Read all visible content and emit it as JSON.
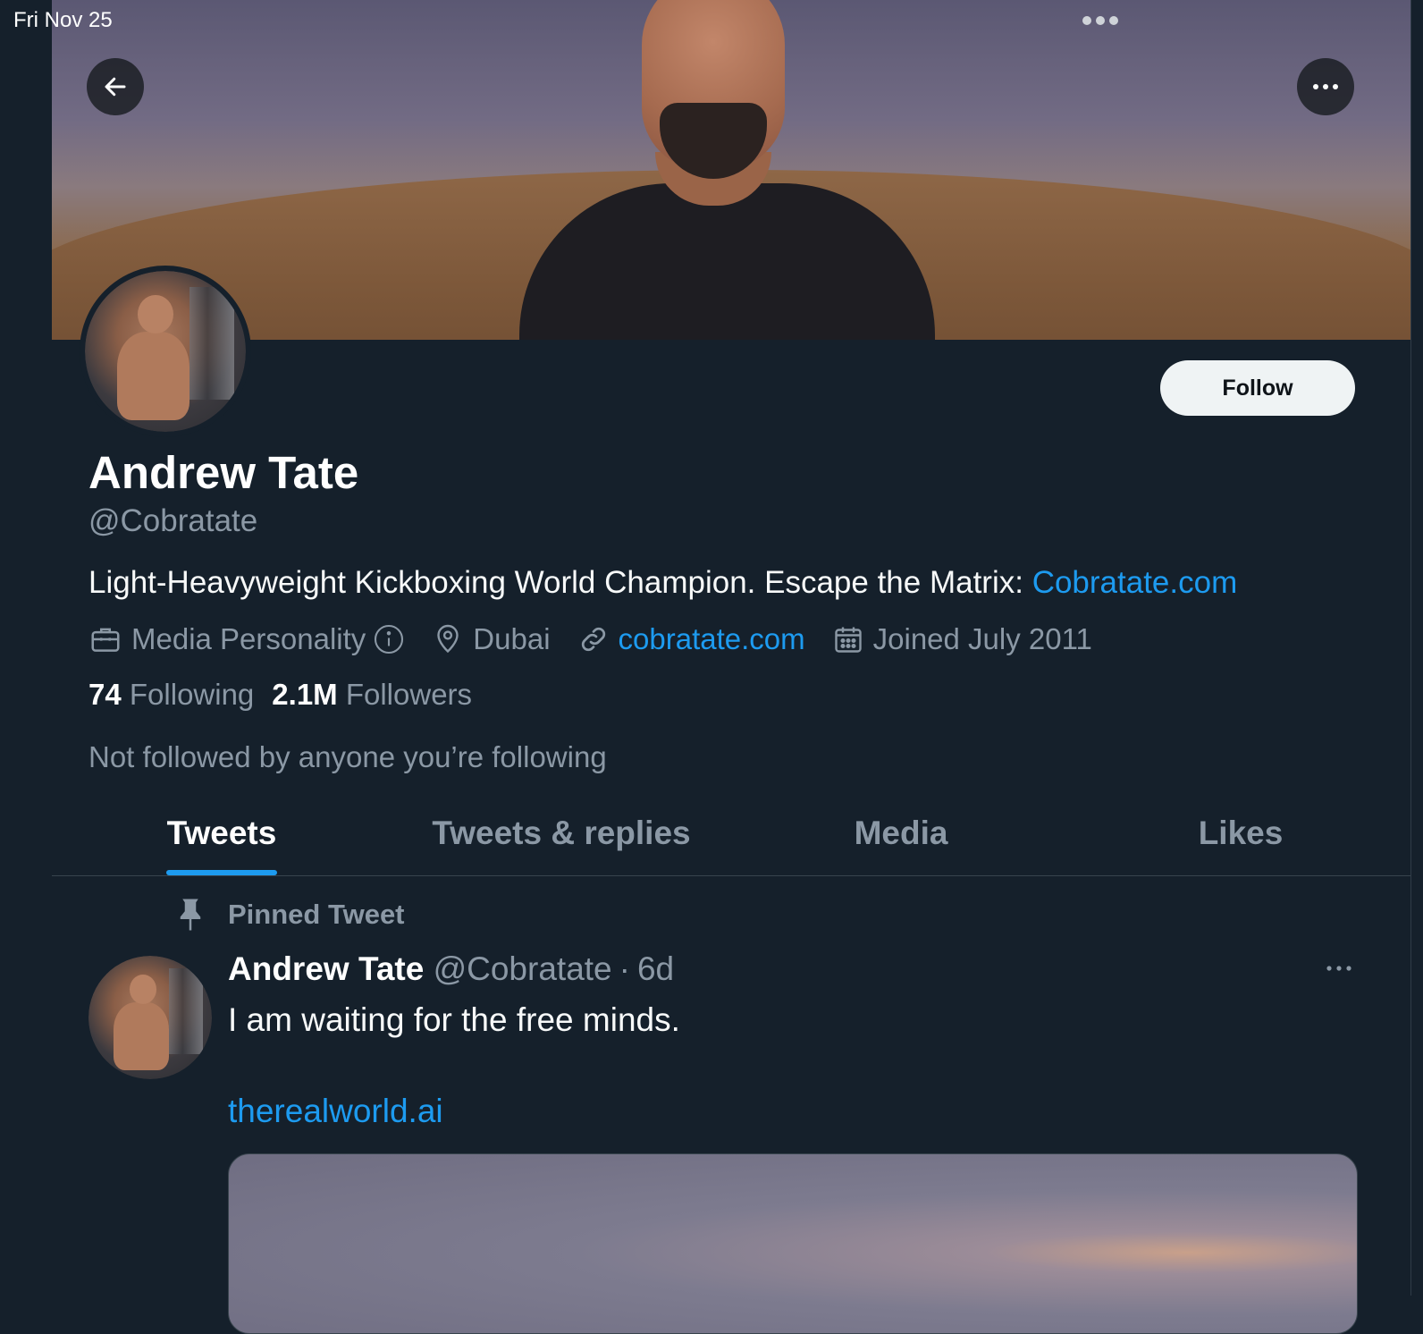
{
  "status_bar": {
    "date": "Fri Nov 25"
  },
  "profile": {
    "display_name": "Andrew Tate",
    "handle": "@Cobratate",
    "follow_label": "Follow",
    "bio_text": "Light-Heavyweight Kickboxing World Champion. Escape the Matrix: ",
    "bio_link": "Cobratate.com",
    "category": "Media Personality",
    "location": "Dubai",
    "website": "cobratate.com",
    "joined": "Joined July 2011",
    "following_count": "74",
    "following_label": "Following",
    "followers_count": "2.1M",
    "followers_label": "Followers",
    "not_followed_text": "Not followed by anyone you’re following"
  },
  "tabs": [
    {
      "label": "Tweets",
      "active": true
    },
    {
      "label": "Tweets & replies",
      "active": false
    },
    {
      "label": "Media",
      "active": false
    },
    {
      "label": "Likes",
      "active": false
    }
  ],
  "pinned_tweet": {
    "pinned_label": "Pinned Tweet",
    "author_name": "Andrew Tate",
    "author_handle": "@Cobratate",
    "separator": "·",
    "time_ago": "6d",
    "text": "I am waiting for the free minds.",
    "link": "therealworld.ai"
  },
  "icons": {
    "back": "arrow-left-icon",
    "more": "more-horizontal-icon",
    "category": "briefcase-icon",
    "info": "info-icon",
    "location": "location-pin-icon",
    "website": "link-icon",
    "joined": "calendar-icon",
    "pin": "pin-icon"
  },
  "colors": {
    "background": "#15202b",
    "accent": "#1d9bf0",
    "muted_text": "#8b98a5",
    "follow_button_bg": "#eff3f4"
  }
}
